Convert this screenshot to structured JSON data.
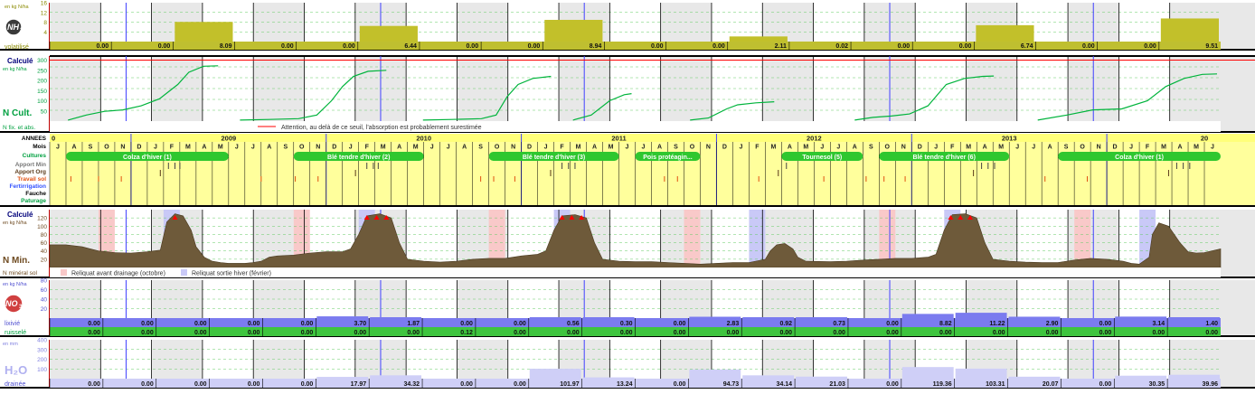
{
  "colors": {
    "grid_bg": "#e8e8e8",
    "white_bg": "#ffffff",
    "olive": "#c2c02a",
    "olive_row": "#bfbf30",
    "green_line": "#00b43c",
    "red_line": "#ff0000",
    "brown": "#6e5a3a",
    "yellow": "#ffff9c",
    "blue_bar": "#7b7bef",
    "blue_light": "#cfcff7",
    "green_row": "#3ec43e",
    "pink": "#f9c9c9",
    "lavender": "#c9c9f7",
    "green_pill": "#2fc72f",
    "nav": "#00007a"
  },
  "nh3": {
    "unit": "en kg N/ha",
    "ticks": [
      "16",
      "12",
      "8",
      "4"
    ],
    "ymax": 16,
    "icon_text": "NH",
    "icon_sub": "3",
    "row_label": "volatilisé",
    "values": [
      "0.00",
      "0.00",
      "8.09",
      "0.00",
      "0.00",
      "6.44",
      "0.00",
      "0.00",
      "8.94",
      "0.00",
      "0.00",
      "2.11",
      "0.02",
      "0.00",
      "0.00",
      "6.74",
      "0.00",
      "0.00",
      "9.51"
    ]
  },
  "ncult": {
    "title": "Calculé",
    "unit": "en kg N/ha",
    "ticks": [
      "300",
      "250",
      "200",
      "150",
      "100",
      "50"
    ],
    "ymax": 320,
    "big_label": "N Cult.",
    "sub_label": "N fix. et abs.",
    "legend": "Attention, au delà de ce seuil, l'absorption est probablement surestimée",
    "threshold": 300,
    "curves": [
      [
        [
          0.5,
          5
        ],
        [
          1.0,
          30
        ],
        [
          1.5,
          48
        ],
        [
          2.0,
          55
        ],
        [
          2.5,
          75
        ],
        [
          3.0,
          110
        ],
        [
          3.5,
          180
        ],
        [
          3.8,
          240
        ],
        [
          4.2,
          270
        ],
        [
          4.6,
          272
        ]
      ],
      [
        [
          5.2,
          5
        ],
        [
          6.0,
          8
        ],
        [
          6.8,
          12
        ],
        [
          7.3,
          30
        ],
        [
          7.7,
          100
        ],
        [
          8.0,
          170
        ],
        [
          8.3,
          220
        ],
        [
          8.7,
          245
        ],
        [
          9.2,
          250
        ]
      ],
      [
        [
          10.2,
          5
        ],
        [
          11.0,
          8
        ],
        [
          11.8,
          12
        ],
        [
          12.2,
          30
        ],
        [
          12.5,
          120
        ],
        [
          12.8,
          180
        ],
        [
          13.2,
          210
        ],
        [
          13.7,
          220
        ]
      ],
      [
        [
          14.3,
          5
        ],
        [
          14.8,
          30
        ],
        [
          15.3,
          100
        ],
        [
          15.7,
          130
        ],
        [
          15.9,
          135
        ]
      ],
      [
        [
          17.5,
          5
        ],
        [
          18.0,
          15
        ],
        [
          18.5,
          60
        ],
        [
          18.8,
          80
        ],
        [
          19.3,
          90
        ],
        [
          19.8,
          95
        ]
      ],
      [
        [
          22.0,
          5
        ],
        [
          22.5,
          18
        ],
        [
          23.0,
          25
        ],
        [
          23.5,
          35
        ],
        [
          24.0,
          75
        ],
        [
          24.5,
          180
        ],
        [
          25.0,
          210
        ],
        [
          25.5,
          220
        ],
        [
          25.8,
          222
        ]
      ],
      [
        [
          27.0,
          5
        ],
        [
          27.8,
          30
        ],
        [
          28.5,
          55
        ],
        [
          29.3,
          60
        ],
        [
          30.0,
          100
        ],
        [
          30.5,
          170
        ],
        [
          31.0,
          210
        ],
        [
          31.5,
          230
        ],
        [
          31.9,
          232
        ]
      ]
    ]
  },
  "calendar": {
    "label_annees": "ANNEES",
    "label_mois": "Mois",
    "label_cultures": "Cultures",
    "label_apport_min": "Apport Min",
    "label_apport_org": "Apport Org",
    "label_travail": "Travail sol",
    "label_ferti": "Fertirrigation",
    "label_fauche": "Fauche",
    "label_paturage": "Paturage",
    "years": [
      {
        "label": "2009",
        "start": 5
      },
      {
        "label": "2010",
        "start": 17
      },
      {
        "label": "2011",
        "start": 29
      },
      {
        "label": "2012",
        "start": 41
      },
      {
        "label": "2013",
        "start": 53
      },
      {
        "label": "20",
        "start": 65
      }
    ],
    "months": [
      "J",
      "A",
      "S",
      "O",
      "N",
      "D",
      "J",
      "F",
      "M",
      "A",
      "M",
      "J",
      "J",
      "A",
      "S",
      "O",
      "N",
      "D",
      "J",
      "F",
      "M",
      "A",
      "M",
      "J",
      "J",
      "A",
      "S",
      "O",
      "N",
      "D",
      "J",
      "F",
      "M",
      "A",
      "M",
      "J",
      "J",
      "A",
      "S",
      "O",
      "N",
      "D",
      "J",
      "F",
      "M",
      "A",
      "M",
      "J",
      "J",
      "A",
      "S",
      "O",
      "N",
      "D",
      "J",
      "F",
      "M",
      "A",
      "M",
      "J",
      "J",
      "A",
      "S",
      "O",
      "N",
      "D",
      "J",
      "F",
      "M",
      "A",
      "M",
      "J"
    ],
    "year_start_text": "0",
    "crops": [
      {
        "label": "Colza d'hiver (1)",
        "start": 1,
        "end": 11
      },
      {
        "label": "Blé tendre d'hiver (2)",
        "start": 15,
        "end": 23
      },
      {
        "label": "Blé tendre d'hiver (3)",
        "start": 27,
        "end": 35
      },
      {
        "label": "Pois protéagin...",
        "start": 36,
        "end": 40
      },
      {
        "label": "Tournesol (5)",
        "start": 45,
        "end": 50
      },
      {
        "label": "Blé tendre d'hiver (6)",
        "start": 51,
        "end": 59
      },
      {
        "label": "Colza d'hiver (1)",
        "start": 62,
        "end": 72
      }
    ],
    "apport_min": [
      7.3,
      7.7,
      8.0,
      19.5,
      19.9,
      20.2,
      31.5,
      31.9,
      32.3,
      45.3,
      57.3,
      57.7,
      58.1,
      69.3,
      69.7,
      70.1
    ],
    "apport_org": [
      6.8,
      18.8,
      30.8,
      44.8,
      56.8,
      68.8
    ],
    "travail": [
      1.3,
      3.0,
      4.4,
      13.0,
      15.1,
      16.5,
      26.5,
      27.3,
      28.6,
      37.8,
      38.6,
      43.6,
      47.6,
      50.2,
      51.3,
      52.6,
      61.2,
      63.8
    ]
  },
  "nmin": {
    "title": "Calculé",
    "unit": "en kg N/ha",
    "ticks": [
      "120",
      "100",
      "80",
      "60",
      "40",
      "20"
    ],
    "ymax": 140,
    "big_label": "N Min.",
    "sub_label": "N minéral sol",
    "legend_drainage": "Reliquat avant drainage (octobre)",
    "legend_sortie": "Reliquat sortie hiver (février)",
    "pink_months": [
      3,
      15,
      27,
      39,
      51,
      63
    ],
    "blue_months": [
      7,
      19,
      31,
      43,
      55,
      67
    ],
    "markers": [
      7.7,
      19.5,
      20.1,
      20.7,
      31.5,
      32.1,
      32.7,
      55.4,
      56.0,
      56.6
    ],
    "profile": [
      [
        0,
        55
      ],
      [
        1,
        55
      ],
      [
        2,
        50
      ],
      [
        2.5,
        45
      ],
      [
        3,
        40
      ],
      [
        3.5,
        38
      ],
      [
        4,
        36
      ],
      [
        5,
        35
      ],
      [
        6,
        38
      ],
      [
        6.8,
        42
      ],
      [
        7.2,
        110
      ],
      [
        7.7,
        130
      ],
      [
        8.2,
        125
      ],
      [
        8.7,
        90
      ],
      [
        9.0,
        50
      ],
      [
        9.5,
        25
      ],
      [
        10,
        15
      ],
      [
        10.5,
        12
      ],
      [
        11,
        10
      ],
      [
        12,
        10
      ],
      [
        12.5,
        12
      ],
      [
        13,
        15
      ],
      [
        13.5,
        25
      ],
      [
        14,
        28
      ],
      [
        15,
        30
      ],
      [
        16,
        35
      ],
      [
        17,
        38
      ],
      [
        18,
        38
      ],
      [
        18.5,
        45
      ],
      [
        19,
        80
      ],
      [
        19.5,
        125
      ],
      [
        20.3,
        130
      ],
      [
        21,
        120
      ],
      [
        21.5,
        60
      ],
      [
        22,
        20
      ],
      [
        23,
        15
      ],
      [
        24,
        13
      ],
      [
        25,
        15
      ],
      [
        26,
        20
      ],
      [
        27,
        22
      ],
      [
        28,
        22
      ],
      [
        29,
        28
      ],
      [
        30,
        32
      ],
      [
        30.5,
        40
      ],
      [
        31,
        90
      ],
      [
        31.5,
        125
      ],
      [
        32.3,
        128
      ],
      [
        33,
        120
      ],
      [
        33.5,
        60
      ],
      [
        34,
        20
      ],
      [
        35,
        15
      ],
      [
        36,
        14
      ],
      [
        37,
        14
      ],
      [
        38,
        12
      ],
      [
        39,
        10
      ],
      [
        40,
        8
      ],
      [
        41,
        10
      ],
      [
        42,
        12
      ],
      [
        43,
        12
      ],
      [
        44,
        20
      ],
      [
        44.3,
        40
      ],
      [
        44.7,
        55
      ],
      [
        45.2,
        58
      ],
      [
        45.7,
        45
      ],
      [
        46,
        25
      ],
      [
        46.5,
        15
      ],
      [
        48,
        14
      ],
      [
        49,
        15
      ],
      [
        50,
        18
      ],
      [
        51,
        20
      ],
      [
        52,
        22
      ],
      [
        53,
        22
      ],
      [
        54,
        25
      ],
      [
        54.5,
        32
      ],
      [
        55,
        90
      ],
      [
        55.5,
        128
      ],
      [
        56.3,
        130
      ],
      [
        57,
        120
      ],
      [
        57.5,
        60
      ],
      [
        58,
        20
      ],
      [
        59,
        15
      ],
      [
        60,
        13
      ],
      [
        61,
        12
      ],
      [
        62,
        12
      ],
      [
        63,
        18
      ],
      [
        64,
        22
      ],
      [
        65,
        20
      ],
      [
        66,
        15
      ],
      [
        66.5,
        10
      ],
      [
        67,
        8
      ],
      [
        67.6,
        25
      ],
      [
        67.8,
        80
      ],
      [
        68.2,
        108
      ],
      [
        68.8,
        100
      ],
      [
        69.5,
        60
      ],
      [
        70,
        38
      ],
      [
        70.5,
        35
      ],
      [
        71,
        36
      ],
      [
        72,
        45
      ]
    ]
  },
  "no3": {
    "unit": "en kg N/ha",
    "ticks": [
      "80",
      "60",
      "40",
      "20"
    ],
    "ymax": 80,
    "icon_text": "NO",
    "icon_sub": "3",
    "row_label_1": "lixivié",
    "row_label_2": "ruisselé",
    "lix": [
      "0.00",
      "0.00",
      "0.00",
      "0.00",
      "0.00",
      "3.70",
      "1.87",
      "0.00",
      "0.00",
      "0.56",
      "0.30",
      "0.00",
      "2.83",
      "0.92",
      "0.73",
      "0.00",
      "8.82",
      "11.22",
      "2.90",
      "0.00",
      "3.14",
      "1.40"
    ],
    "rui": [
      "0.00",
      "0.00",
      "0.00",
      "0.00",
      "0.00",
      "0.00",
      "0.00",
      "0.12",
      "0.00",
      "0.00",
      "0.00",
      "0.00",
      "0.00",
      "0.00",
      "0.00",
      "0.00",
      "0.00",
      "0.00",
      "0.00",
      "0.00",
      "0.00",
      "0.00"
    ]
  },
  "h2o": {
    "unit": "en mm",
    "ticks": [
      "400",
      "300",
      "200",
      "100"
    ],
    "ymax": 400,
    "icon_text": "H₂O",
    "row_label": "drainée",
    "values": [
      "0.00",
      "0.00",
      "0.00",
      "0.00",
      "0.00",
      "17.97",
      "34.32",
      "0.00",
      "0.00",
      "101.97",
      "13.24",
      "0.00",
      "94.73",
      "34.14",
      "21.03",
      "0.00",
      "119.36",
      "103.31",
      "20.07",
      "0.00",
      "30.35",
      "39.96"
    ]
  }
}
